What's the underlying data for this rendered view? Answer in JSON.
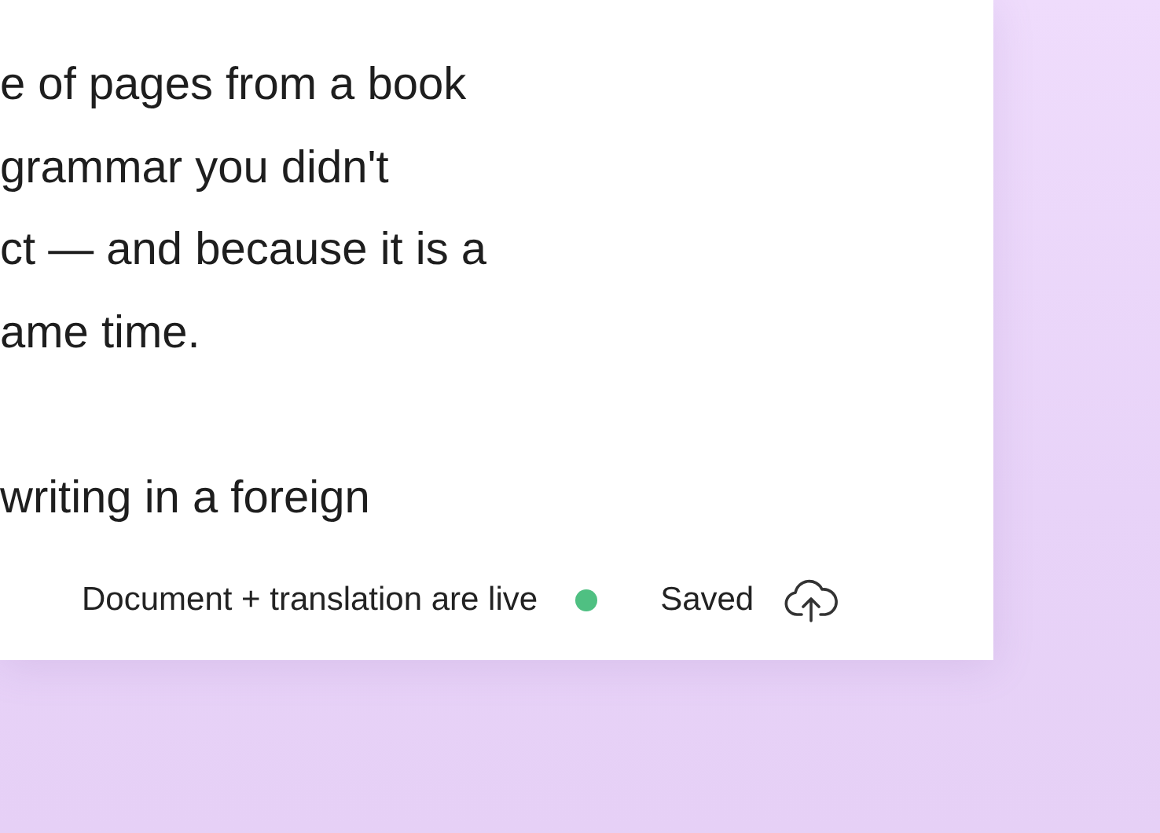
{
  "document": {
    "paragraphs": [
      {
        "lines": [
          "e of pages from a book",
          "grammar you didn't",
          "ct — and because it is a",
          "ame time."
        ]
      },
      {
        "lines": [
          "writing in a foreign"
        ]
      }
    ]
  },
  "status_bar": {
    "live_text": "Document + translation are live",
    "live": true,
    "saved_text": "Saved"
  }
}
